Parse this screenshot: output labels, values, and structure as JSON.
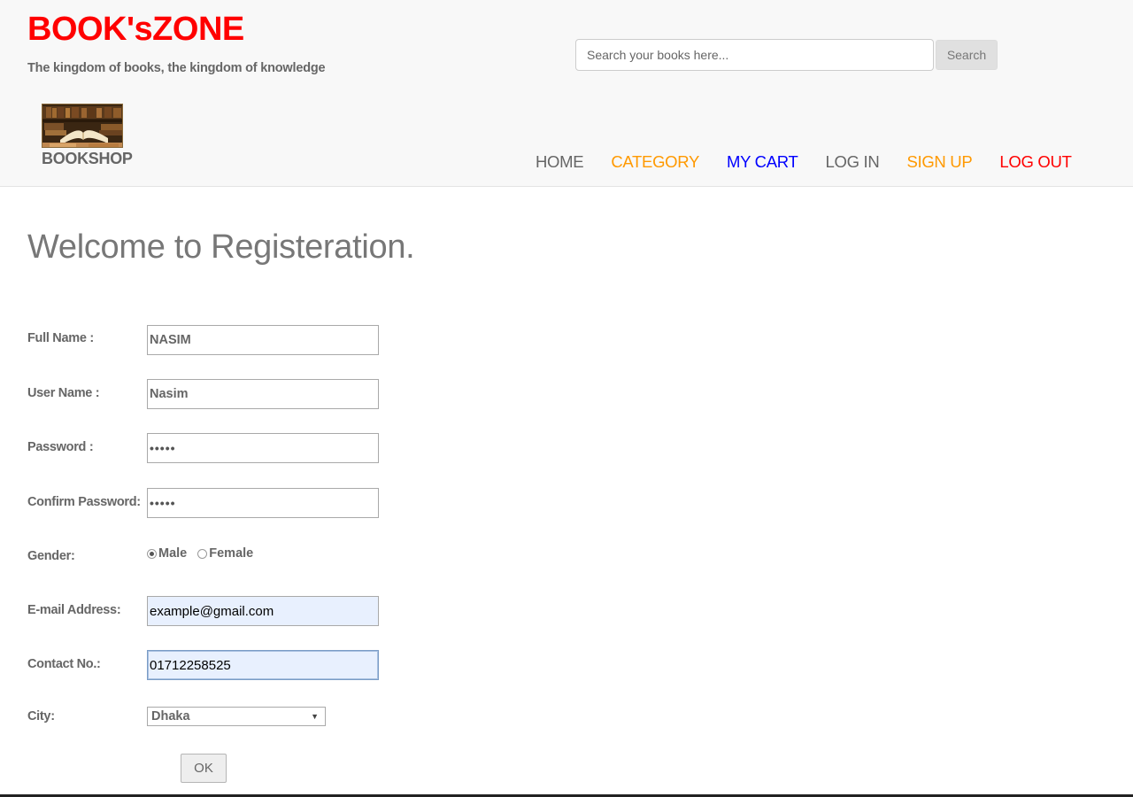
{
  "header": {
    "site_title": "BOOK'sZONE",
    "tagline": "The kingdom of books, the kingdom of knowledge",
    "brand_label": "BOOKSHOP",
    "title_color": "#ff0000",
    "search": {
      "placeholder": "Search your books here...",
      "button_label": "Search"
    }
  },
  "nav": {
    "items": [
      {
        "label": "HOME",
        "color": "#666666"
      },
      {
        "label": "CATEGORY",
        "color": "#ff9900"
      },
      {
        "label": "MY CART",
        "color": "#0000ff"
      },
      {
        "label": "LOG IN",
        "color": "#666666"
      },
      {
        "label": "SIGN UP",
        "color": "#ff9900"
      },
      {
        "label": "LOG OUT",
        "color": "#ff0000"
      }
    ]
  },
  "main": {
    "heading": "Welcome to Registeration.",
    "form": {
      "full_name": {
        "label": "Full Name :",
        "value": "NASIM"
      },
      "user_name": {
        "label": "User Name :",
        "value": "Nasim"
      },
      "password": {
        "label": "Password :",
        "value": "•••••"
      },
      "confirm_password": {
        "label": "Confirm Password:",
        "value": "•••••"
      },
      "gender": {
        "label": "Gender:",
        "options": [
          "Male",
          "Female"
        ],
        "selected": "Male"
      },
      "email": {
        "label": "E-mail Address:",
        "value": "example@gmail.com"
      },
      "contact": {
        "label": "Contact No.:",
        "value": "01712258525"
      },
      "city": {
        "label": "City:",
        "selected": "Dhaka"
      },
      "submit_label": "OK"
    }
  }
}
